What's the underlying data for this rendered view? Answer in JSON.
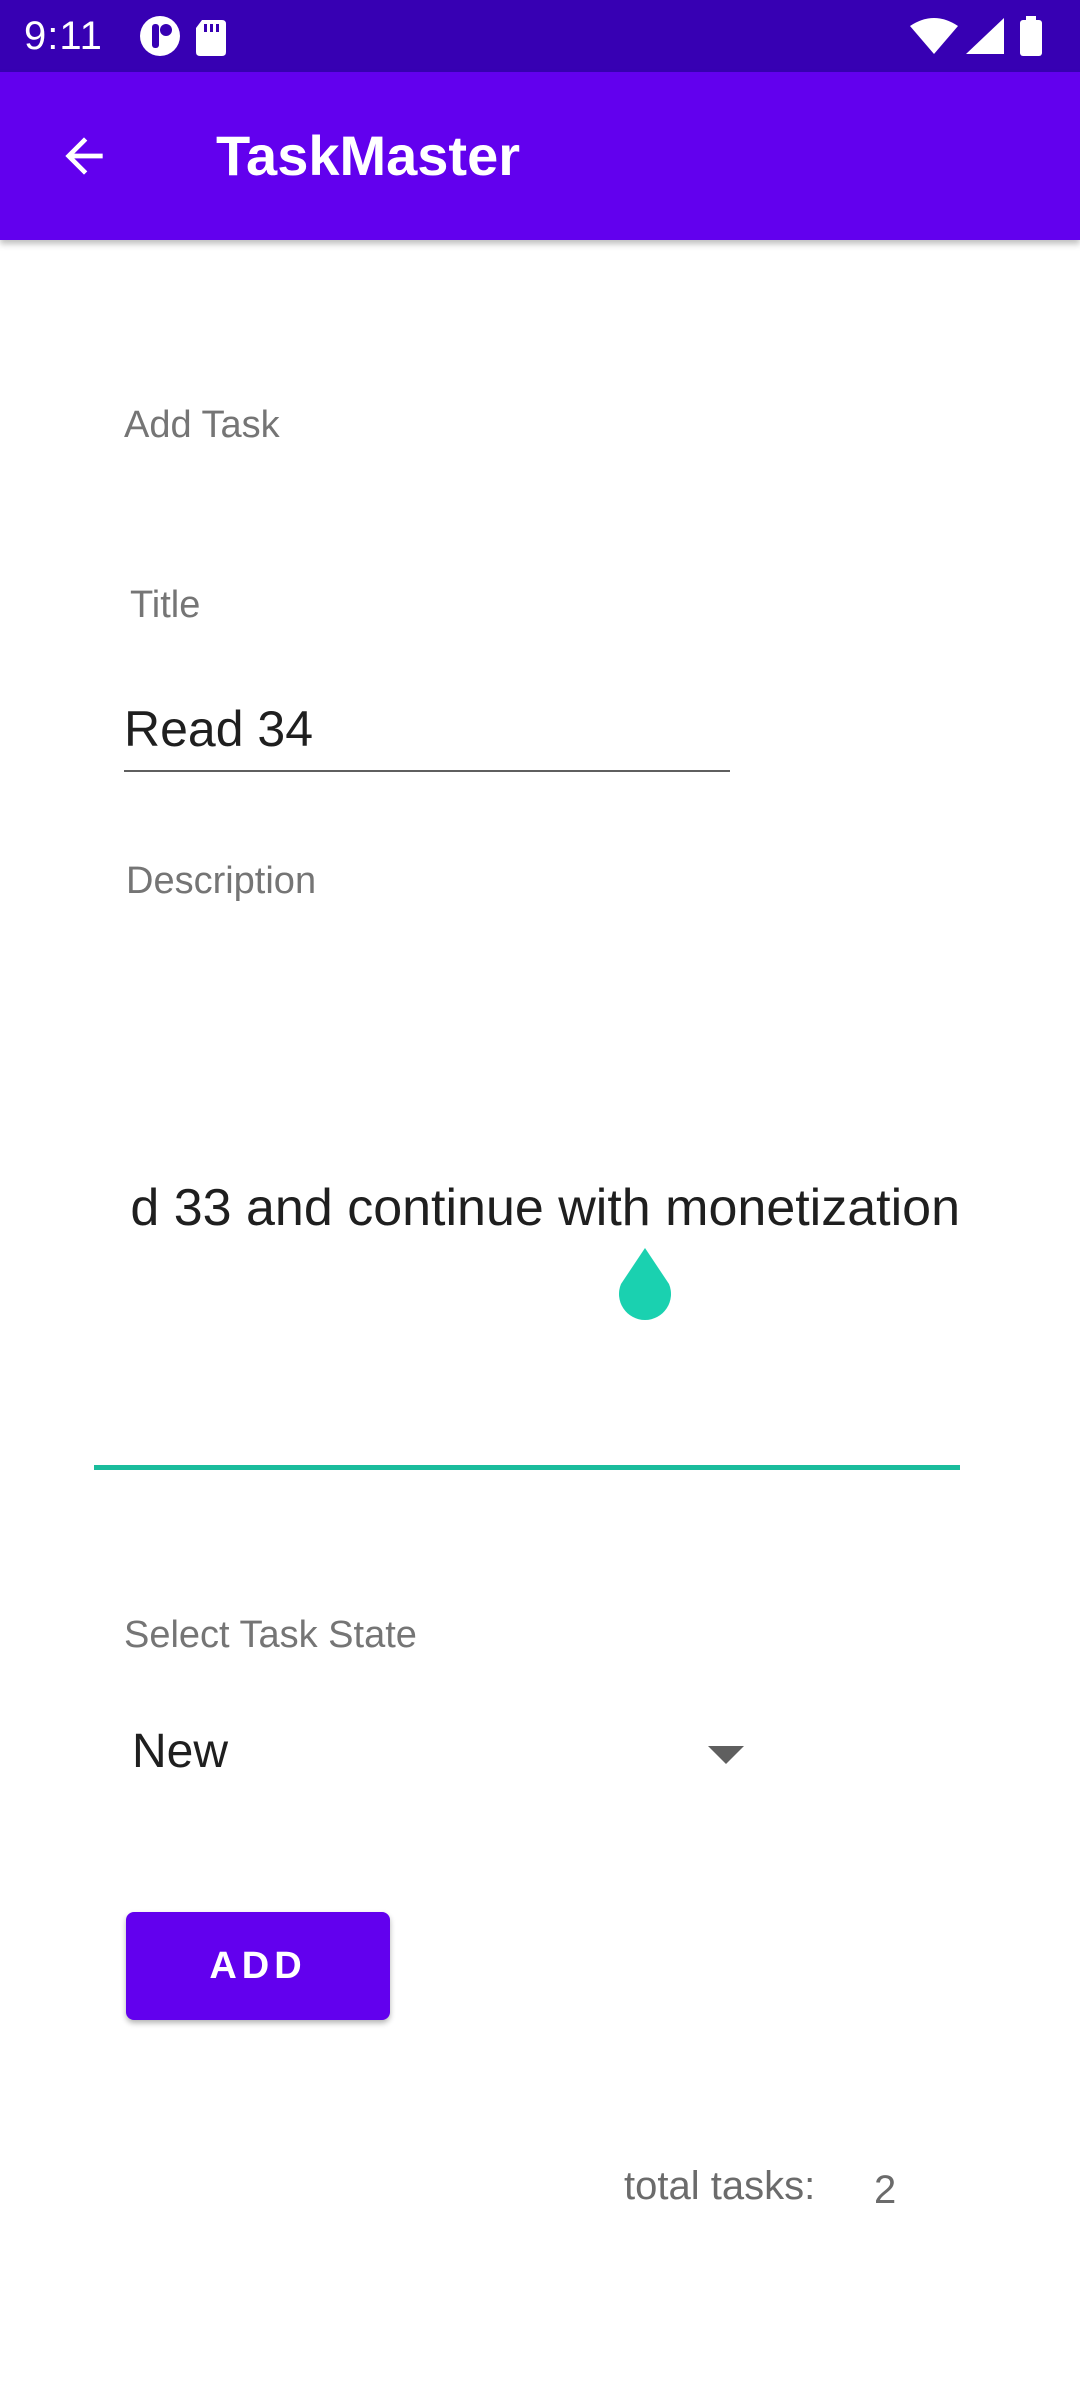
{
  "status_bar": {
    "time": "9:11",
    "left_icons": [
      "notification-icon",
      "sd-card-icon"
    ],
    "right_icons": [
      "wifi-icon",
      "signal-icon",
      "battery-icon"
    ]
  },
  "app_bar": {
    "title": "TaskMaster",
    "back_icon": "arrow-back-icon",
    "color": "#6200ee",
    "status_color": "#3700b3"
  },
  "form": {
    "section_label": "Add Task",
    "title_label": "Title",
    "title_value": "Read 34",
    "description_label": "Description",
    "description_value": "d 33 and continue with monetization",
    "description_accent_color": "#1abc9c",
    "state_label": "Select Task State",
    "state_value": "New",
    "add_button_label": "ADD"
  },
  "footer": {
    "total_label": "total tasks:",
    "total_value": "2"
  }
}
